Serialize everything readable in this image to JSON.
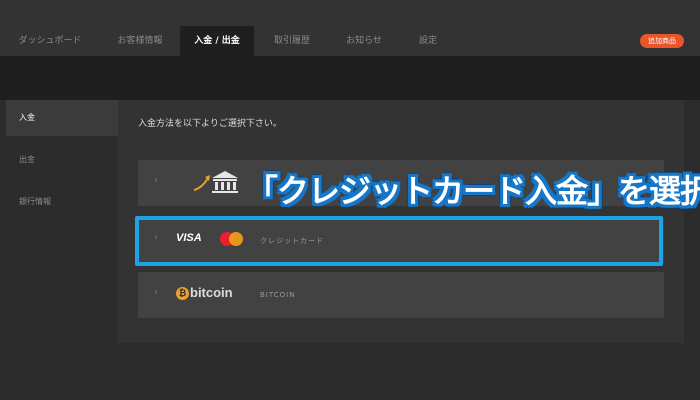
{
  "nav": {
    "tabs": [
      {
        "label": "ダッシュボード",
        "active": false
      },
      {
        "label": "お客様情報",
        "active": false
      },
      {
        "label": "入金 / 出金",
        "active": true
      },
      {
        "label": "取引履歴",
        "active": false
      },
      {
        "label": "お知らせ",
        "active": false
      },
      {
        "label": "設定",
        "active": false
      }
    ],
    "badge": "追加商品"
  },
  "sidebar": {
    "items": [
      {
        "label": "入金",
        "active": true
      },
      {
        "label": "出金",
        "active": false
      },
      {
        "label": "銀行情報",
        "active": false
      }
    ]
  },
  "main": {
    "instruction": "入金方法を以下よりご選択下さい。",
    "methods": [
      {
        "name": "bank",
        "icon": "bank-icon",
        "label": ""
      },
      {
        "name": "card",
        "brands": [
          "VISA",
          "mastercard-icon"
        ],
        "label": "クレジットカード"
      },
      {
        "name": "bitcoin",
        "logo_text": "bitcoin",
        "label": "BITCOIN"
      }
    ]
  },
  "overlay": {
    "caption": "「クレジットカード入金」を選択"
  },
  "colors": {
    "accent_badge": "#e8562a",
    "highlight": "#1ea3e6",
    "bitcoin": "#e8a22c"
  }
}
